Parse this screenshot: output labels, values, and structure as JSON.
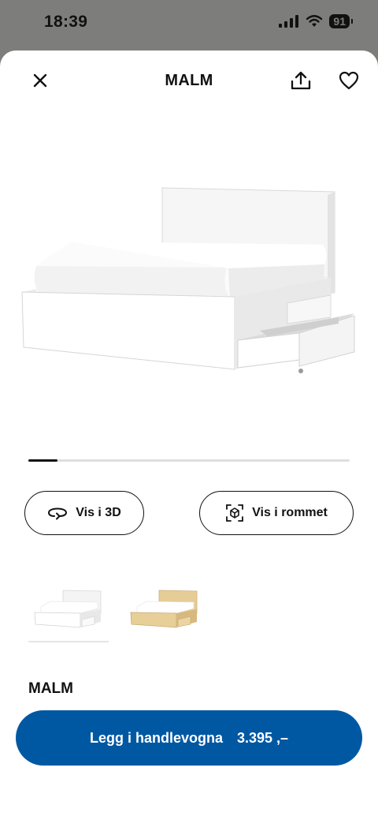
{
  "status_bar": {
    "time": "18:39",
    "battery": "91"
  },
  "header": {
    "title": "MALM"
  },
  "gallery": {
    "progress": 0.09
  },
  "actions": {
    "view_3d_label": "Vis i 3D",
    "view_room_label": "Vis i rommet"
  },
  "variants": [
    {
      "color": "white"
    },
    {
      "color": "oak veneer"
    }
  ],
  "product": {
    "name": "MALM"
  },
  "cart": {
    "label": "Legg i handlevogna",
    "price": "3.395 ,–"
  },
  "colors": {
    "cart_button": "#0058a3",
    "oak": "#e3c88f"
  },
  "icons": [
    "close-icon",
    "share-icon",
    "heart-icon",
    "rotate-3d-icon",
    "ar-cube-icon"
  ]
}
